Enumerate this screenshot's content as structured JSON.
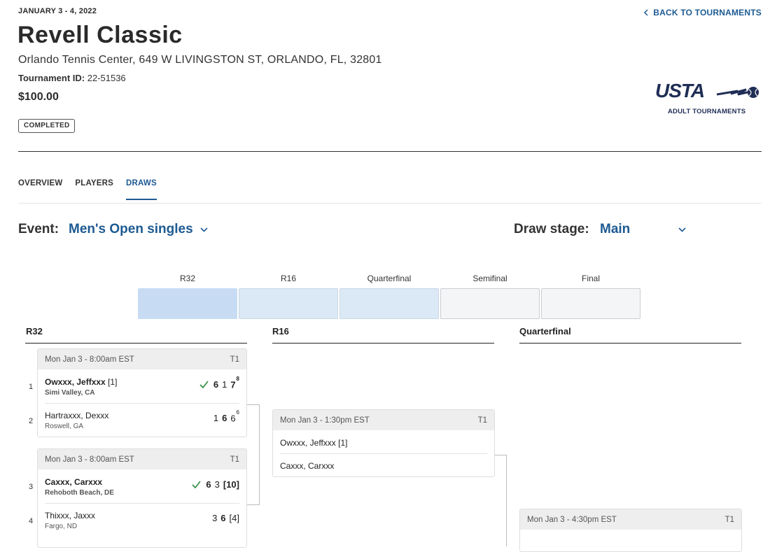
{
  "header": {
    "date": "JANUARY 3 - 4, 2022",
    "back_link": "BACK TO TOURNAMENTS",
    "title": "Revell Classic",
    "venue": "Orlando Tennis Center, 649 W LIVINGSTON ST, ORLANDO, FL, 32801",
    "tournament_id_label": "Tournament ID:",
    "tournament_id": "22-51536",
    "price": "$100.00",
    "status": "COMPLETED",
    "logo_text": "USTA",
    "logo_sub": "ADULT TOURNAMENTS"
  },
  "tabs": [
    {
      "label": "OVERVIEW",
      "active": false
    },
    {
      "label": "PLAYERS",
      "active": false
    },
    {
      "label": "DRAWS",
      "active": true
    }
  ],
  "filters": {
    "event_label": "Event:",
    "event_value": "Men's Open singles",
    "stage_label": "Draw stage:",
    "stage_value": "Main"
  },
  "rounds_nav": [
    "R32",
    "R16",
    "Quarterfinal",
    "Semifinal",
    "Final"
  ],
  "columns": [
    "R32",
    "R16",
    "Quarterfinal"
  ],
  "r32_matches": [
    {
      "time": "Mon Jan 3 - 8:00am EST",
      "court": "T1",
      "players": [
        {
          "num": "1",
          "name": "Owxxx, Jeffxxx",
          "seed": "[1]",
          "loc": "Simi Valley, CA",
          "winner": true,
          "sets": [
            {
              "v": "6",
              "w": true
            },
            {
              "v": "1",
              "w": false
            },
            {
              "v": "7",
              "w": true,
              "tb": "8"
            }
          ]
        },
        {
          "num": "2",
          "name": "Hartraxxx, Dexxx",
          "seed": "",
          "loc": "Roswell, GA",
          "winner": false,
          "sets": [
            {
              "v": "1",
              "w": false
            },
            {
              "v": "6",
              "w": true
            },
            {
              "v": "6",
              "w": false,
              "tb": "6"
            }
          ]
        }
      ]
    },
    {
      "time": "Mon Jan 3 - 8:00am EST",
      "court": "T1",
      "players": [
        {
          "num": "3",
          "name": "Caxxx, Carxxx",
          "seed": "",
          "loc": "Rehoboth Beach, DE",
          "winner": true,
          "sets": [
            {
              "v": "6",
              "w": true
            },
            {
              "v": "3",
              "w": false
            },
            {
              "v": "[10]",
              "w": true
            }
          ]
        },
        {
          "num": "4",
          "name": "Thixxx, Jaxxx",
          "seed": "",
          "loc": "Fargo, ND",
          "winner": false,
          "sets": [
            {
              "v": "3",
              "w": false
            },
            {
              "v": "6",
              "w": true
            },
            {
              "v": "[4]",
              "w": false
            }
          ]
        }
      ]
    }
  ],
  "r16_match": {
    "time": "Mon Jan 3 - 1:30pm EST",
    "court": "T1",
    "players": [
      {
        "name": "Owxxx, Jeffxxx",
        "seed": "[1]"
      },
      {
        "name": "Caxxx, Carxxx",
        "seed": ""
      }
    ]
  },
  "qf_match": {
    "time": "Mon Jan 3 - 4:30pm EST",
    "court": "T1"
  }
}
